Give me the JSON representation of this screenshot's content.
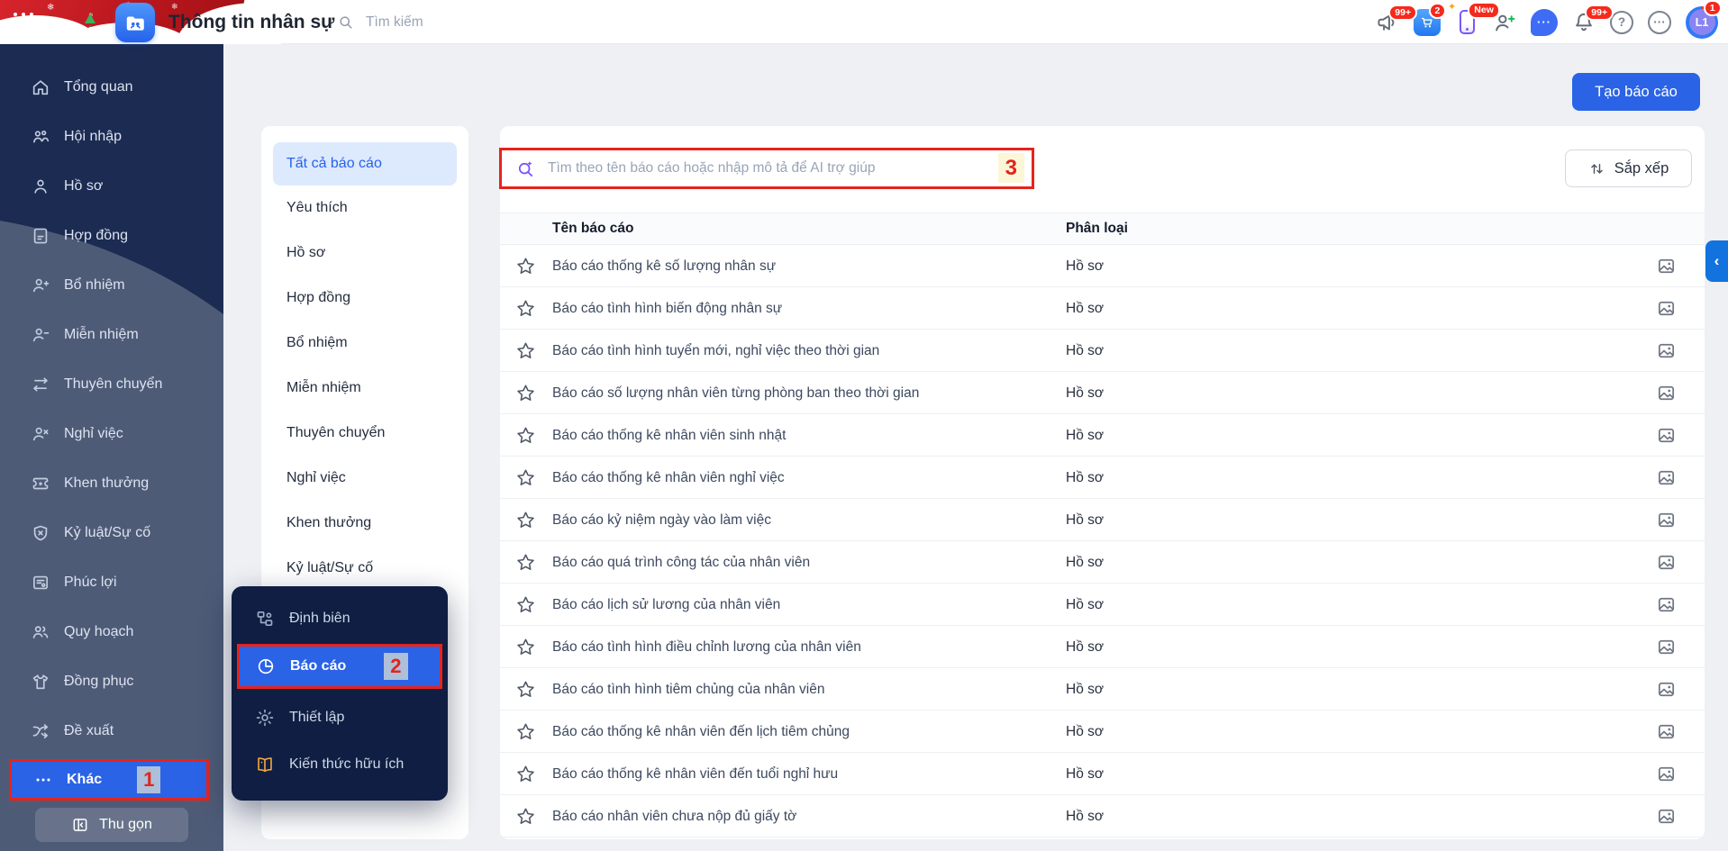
{
  "topbar": {
    "app_title": "Thông tin nhân sự",
    "search_placeholder": "Tìm kiếm",
    "icons": [
      {
        "name": "megaphone-icon",
        "badge": "99+"
      },
      {
        "name": "cart-app-icon",
        "badge": "2"
      },
      {
        "name": "phone-new-icon",
        "badge": "New"
      },
      {
        "name": "add-user-icon"
      },
      {
        "name": "chat-icon",
        "glyph": "···"
      },
      {
        "name": "bell-icon",
        "badge": "99+"
      },
      {
        "name": "help-icon",
        "glyph": "?"
      },
      {
        "name": "more-circle-icon",
        "glyph": "···"
      },
      {
        "name": "user-avatar",
        "label": "L1",
        "badge": "1"
      }
    ]
  },
  "sidebar": {
    "items": [
      {
        "label": "Tổng quan",
        "icon": "home-icon"
      },
      {
        "label": "Hội nhập",
        "icon": "onboarding-icon"
      },
      {
        "label": "Hồ sơ",
        "icon": "profile-icon"
      },
      {
        "label": "Hợp đồng",
        "icon": "contract-icon"
      },
      {
        "label": "Bổ nhiệm",
        "icon": "person-plus-icon"
      },
      {
        "label": "Miễn nhiệm",
        "icon": "person-minus-icon"
      },
      {
        "label": "Thuyên chuyển",
        "icon": "transfer-icon"
      },
      {
        "label": "Nghỉ việc",
        "icon": "person-x-icon"
      },
      {
        "label": "Khen thưởng",
        "icon": "reward-icon"
      },
      {
        "label": "Kỷ luật/Sự cố",
        "icon": "shield-x-icon"
      },
      {
        "label": "Phúc lợi",
        "icon": "benefit-icon"
      },
      {
        "label": "Quy hoạch",
        "icon": "planning-icon"
      },
      {
        "label": "Đồng phục",
        "icon": "uniform-icon"
      },
      {
        "label": "Đề xuất",
        "icon": "proposal-icon"
      },
      {
        "label": "Khác",
        "icon": "more-dots-icon",
        "active": true,
        "annotation": "1"
      }
    ],
    "collapse_label": "Thu gọn",
    "collapse_icon": "collapse-icon"
  },
  "popup_menu": {
    "items": [
      {
        "label": "Định biên",
        "icon": "org-icon"
      },
      {
        "label": "Báo cáo",
        "icon": "pie-chart-icon",
        "active": true,
        "annotation": "2"
      },
      {
        "label": "Thiết lập",
        "icon": "gear-icon"
      },
      {
        "label": "Kiến thức hữu ích",
        "icon": "book-icon",
        "color": "#f2a43c"
      }
    ]
  },
  "category_panel": {
    "items": [
      {
        "label": "Tất cả báo cáo",
        "active": true
      },
      {
        "label": "Yêu thích"
      },
      {
        "label": "Hồ sơ"
      },
      {
        "label": "Hợp đồng"
      },
      {
        "label": "Bổ nhiệm"
      },
      {
        "label": "Miễn nhiệm"
      },
      {
        "label": "Thuyên chuyển"
      },
      {
        "label": "Nghỉ việc"
      },
      {
        "label": "Khen thưởng"
      },
      {
        "label": "Kỷ luật/Sự cố"
      }
    ]
  },
  "main": {
    "create_button": "Tạo báo cáo",
    "ai_search_placeholder": "Tìm theo tên báo cáo hoặc nhập mô tả để AI trợ giúp",
    "ai_search_annotation": "3",
    "sort_button": "Sắp xếp",
    "collapse_tab_glyph": "‹",
    "table": {
      "columns": [
        "Tên báo cáo",
        "Phân loại"
      ],
      "rows": [
        {
          "name": "Báo cáo thống kê số lượng nhân sự",
          "category": "Hồ sơ"
        },
        {
          "name": "Báo cáo tình hình biến động nhân sự",
          "category": "Hồ sơ"
        },
        {
          "name": "Báo cáo tình hình tuyển mới, nghỉ việc theo thời gian",
          "category": "Hồ sơ"
        },
        {
          "name": "Báo cáo số lượng nhân viên từng phòng ban theo thời gian",
          "category": "Hồ sơ"
        },
        {
          "name": "Báo cáo thống kê nhân viên sinh nhật",
          "category": "Hồ sơ"
        },
        {
          "name": "Báo cáo thống kê nhân viên nghỉ việc",
          "category": "Hồ sơ"
        },
        {
          "name": "Báo cáo kỷ niệm ngày vào làm việc",
          "category": "Hồ sơ"
        },
        {
          "name": "Báo cáo quá trình công tác của nhân viên",
          "category": "Hồ sơ"
        },
        {
          "name": "Báo cáo lịch sử lương của nhân viên",
          "category": "Hồ sơ"
        },
        {
          "name": "Báo cáo tình hình điều chỉnh lương của nhân viên",
          "category": "Hồ sơ"
        },
        {
          "name": "Báo cáo tình hình tiêm chủng của nhân viên",
          "category": "Hồ sơ"
        },
        {
          "name": "Báo cáo thống kê nhân viên đến lịch tiêm chủng",
          "category": "Hồ sơ"
        },
        {
          "name": "Báo cáo thống kê nhân viên đến tuổi nghỉ hưu",
          "category": "Hồ sơ"
        },
        {
          "name": "Báo cáo nhân viên chưa nộp đủ giấy tờ",
          "category": "Hồ sơ"
        }
      ]
    }
  },
  "colors": {
    "accent_blue": "#2b63e6",
    "annotation_red": "#e7231c",
    "sidebar_bg": "#1b2b52",
    "sidebar_wave": "#4e5b77",
    "popup_bg": "#0f1e42",
    "active_category_bg": "#dde9fd",
    "edge_tab_blue": "#1273de",
    "badge_red": "#f42a1d"
  }
}
